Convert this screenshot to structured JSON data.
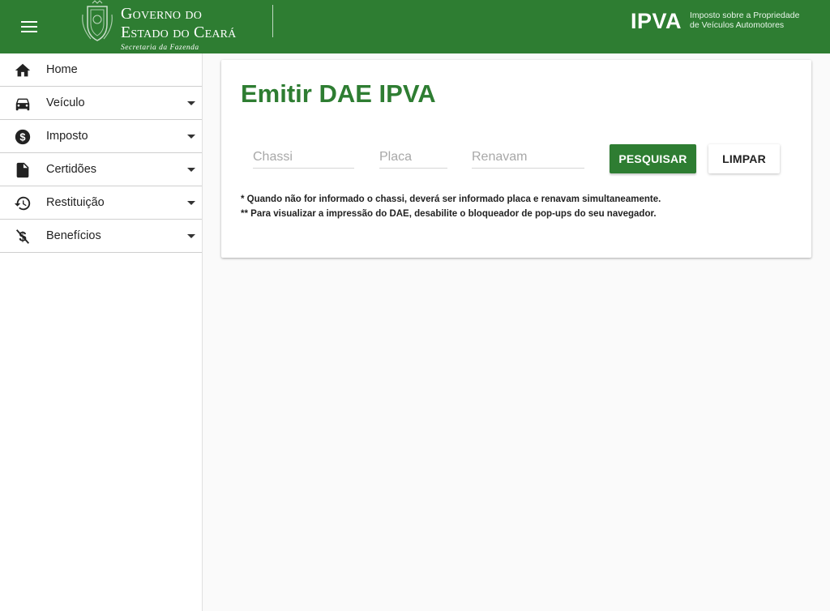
{
  "header": {
    "gov_line1_a": "G",
    "gov_line1_b": "overno",
    "gov_line1_c": "do",
    "gov_line2_a": "E",
    "gov_line2_b": "stado",
    "gov_line2_c": "do",
    "gov_line2_d": "C",
    "gov_line2_e": "eará",
    "gov_line3": "Secretaria da Fazenda",
    "app_logo": "IPVA",
    "app_sub_line1": "Imposto sobre a Propriedade",
    "app_sub_line2": "de Veículos Automotores",
    "brand_color": "#2e7d32"
  },
  "sidebar": {
    "items": [
      {
        "label": "Home",
        "icon": "home-icon",
        "expandable": false
      },
      {
        "label": "Veículo",
        "icon": "car-icon",
        "expandable": true
      },
      {
        "label": "Imposto",
        "icon": "dollar-circle-icon",
        "expandable": true
      },
      {
        "label": "Certidões",
        "icon": "document-icon",
        "expandable": true
      },
      {
        "label": "Restituição",
        "icon": "restore-icon",
        "expandable": true
      },
      {
        "label": "Benefícios",
        "icon": "money-off-icon",
        "expandable": true
      }
    ]
  },
  "main": {
    "title": "Emitir DAE IPVA",
    "fields": {
      "chassi_placeholder": "Chassi",
      "placa_placeholder": "Placa",
      "renavam_placeholder": "Renavam",
      "chassi_value": "",
      "placa_value": "",
      "renavam_value": ""
    },
    "buttons": {
      "search": "PESQUISAR",
      "clear": "LIMPAR"
    },
    "notes": [
      "* Quando não for informado o chassi, deverá ser informado placa e renavam simultaneamente.",
      "** Para visualizar a impressão do DAE, desabilite o bloqueador de pop-ups do seu navegador."
    ]
  }
}
